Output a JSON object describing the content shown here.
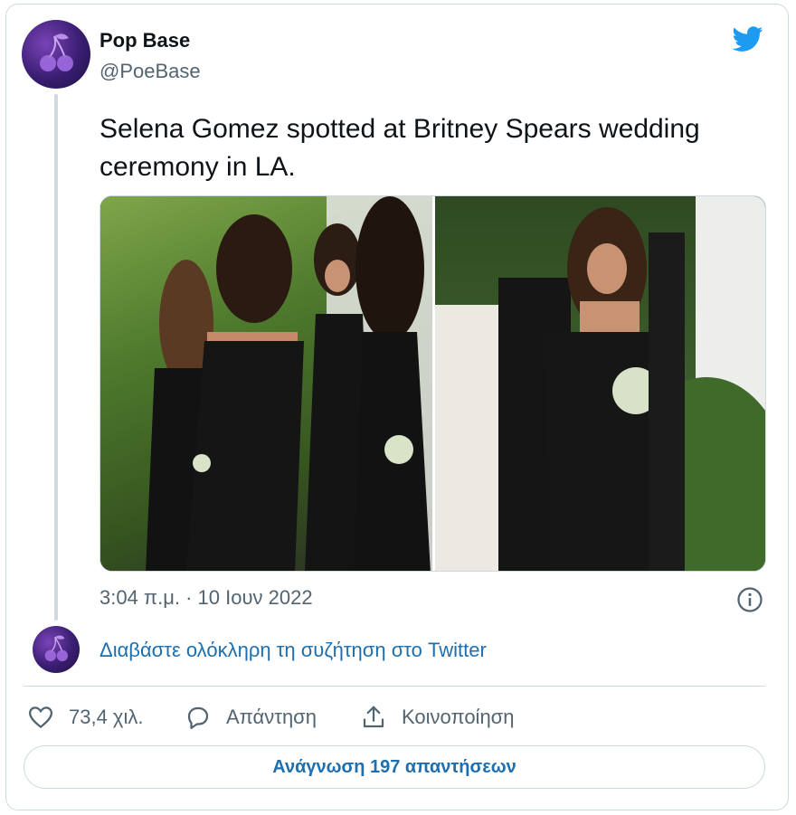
{
  "tweet": {
    "author_name": "Pop Base",
    "author_handle": "@PoeBase",
    "text": "Selena Gomez spotted at Britney Spears wedding ceremony in LA.",
    "timestamp": "3:04 π.μ. · 10 Ιουν 2022",
    "read_conversation": "Διαβάστε ολόκληρη τη συζήτηση στο Twitter",
    "images": [
      {
        "alt": "photo-left"
      },
      {
        "alt": "photo-right"
      }
    ]
  },
  "actions": {
    "like_count": "73,4 χιλ.",
    "reply_label": "Απάντηση",
    "share_label": "Κοινοποίηση"
  },
  "replies_button": "Ανάγνωση 197 απαντήσεων",
  "icons": {
    "brand": "twitter-bird-icon",
    "avatar": "cherry-icon",
    "info": "info-icon",
    "like": "heart-icon",
    "reply": "speech-bubble-icon",
    "share": "share-icon"
  },
  "colors": {
    "link": "#1d6fb0",
    "twitter_blue": "#1d9bf0",
    "secondary_text": "#536471",
    "border": "#cfd9de"
  }
}
